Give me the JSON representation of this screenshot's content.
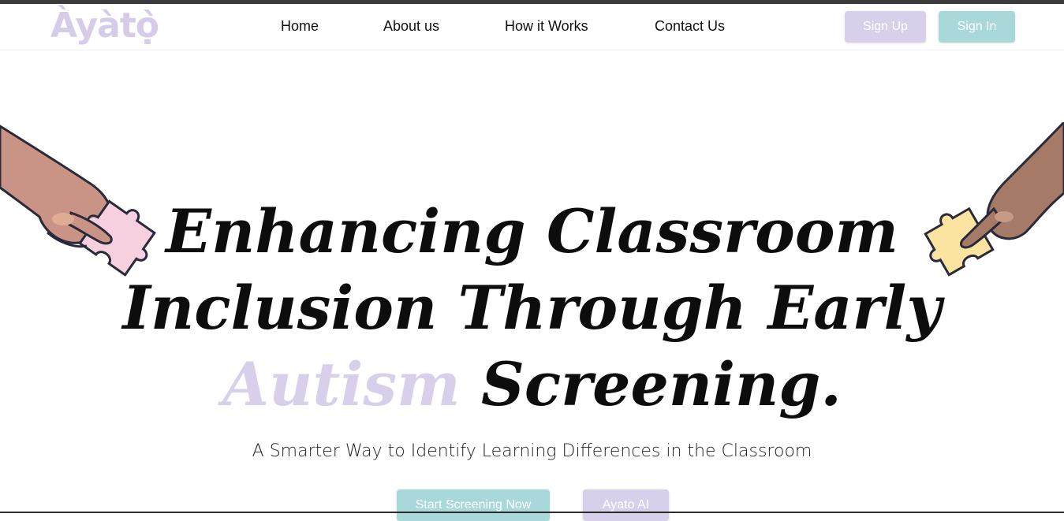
{
  "brand": {
    "logo_text": "Àyàtọ̀"
  },
  "nav": {
    "links": [
      {
        "label": "Home"
      },
      {
        "label": "About us"
      },
      {
        "label": "How it Works"
      },
      {
        "label": "Contact Us"
      }
    ],
    "sign_up_label": "Sign Up",
    "sign_in_label": "Sign In"
  },
  "hero": {
    "title_line1": "Enhancing Classroom",
    "title_line2": "Inclusion Through Early",
    "title_accent": "Autism",
    "title_line3_rest": " Screening.",
    "subtitle": "A Smarter Way to Identify Learning Differences in the Classroom",
    "cta_primary": "Start Screening Now",
    "cta_secondary": "Ayato AI"
  },
  "colors": {
    "lavender": "#d8cfea",
    "teal": "#a8d8da",
    "puzzle_pink": "#f7d0e0",
    "puzzle_yellow": "#fbe4a0",
    "skin_light": "#c99486",
    "skin_dark": "#a57b67"
  },
  "icons": {
    "left": "hand-with-pink-puzzle-piece",
    "right": "hand-with-yellow-puzzle-piece"
  }
}
